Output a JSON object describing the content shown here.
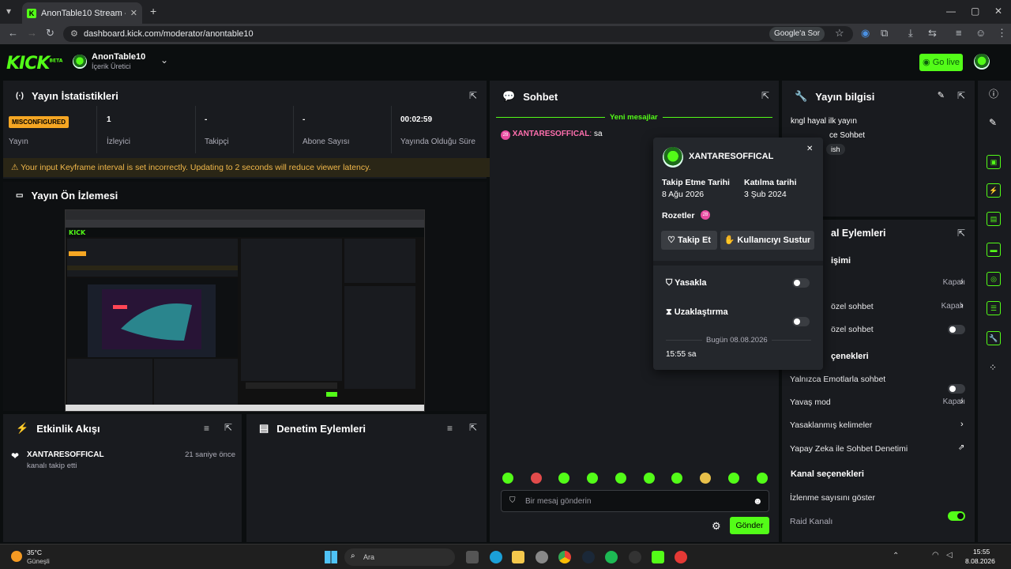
{
  "browser": {
    "tab_title": "AnonTable10 Stream - Kick Da",
    "url": "dashboard.kick.com/moderator/anontable10",
    "google_lens": "Google'a Sor"
  },
  "header": {
    "logo": "KICK",
    "logo_badge": "BETA",
    "channel_name": "AnonTable10",
    "channel_role": "İçerik Üretici",
    "go_live": "Go live"
  },
  "stats": {
    "title": "Yayın İstatistikleri",
    "badge": "MISCONFIGURED",
    "items": [
      {
        "value": "",
        "label": "Yayın"
      },
      {
        "value": "1",
        "label": "İzleyici"
      },
      {
        "value": "-",
        "label": "Takipçi"
      },
      {
        "value": "-",
        "label": "Abone Sayısı"
      },
      {
        "value": "00:02:59",
        "label": "Yayında Olduğu Süre"
      }
    ],
    "warning": "Your input Keyframe interval is set incorrectly. Updating to 2 seconds will reduce viewer latency."
  },
  "preview": {
    "title": "Yayın Ön İzlemesi"
  },
  "activity": {
    "title": "Etkinlik Akışı",
    "items": [
      {
        "user": "XANTARESOFFICAL",
        "text": "kanalı takip etti",
        "time": "21 saniye önce"
      }
    ]
  },
  "moderation": {
    "title": "Denetim Eylemleri"
  },
  "chat": {
    "title": "Sohbet",
    "new_messages": "Yeni mesajlar",
    "messages": [
      {
        "badge": "28",
        "user": "XANTARESOFFICAL",
        "text": "sa"
      }
    ],
    "input_placeholder": "Bir mesaj gönderin",
    "send": "Gönder"
  },
  "user_popup": {
    "username": "XANTARESOFFICAL",
    "follow_label": "Takip Etme Tarihi",
    "follow_date": "8 Ağu 2026",
    "join_label": "Katılma tarihi",
    "join_date": "3 Şub 2024",
    "badges_label": "Rozetler",
    "badge_num": "28",
    "follow_btn": "Takip Et",
    "mute_btn": "Kullanıcıyı Sustur",
    "ban_label": "Yasakla",
    "timeout_label": "Uzaklaştırma",
    "today": "Bugün 08.08.2026",
    "msg_time": "15:55",
    "msg_text": "sa"
  },
  "stream_info": {
    "title": "Yayın bilgisi",
    "stream_title": "kngl hayal ilk yayın",
    "category": "ce Sohbet",
    "tag": "ish"
  },
  "channel_actions": {
    "title": "al Eylemleri",
    "section1": "işimi",
    "rows": [
      {
        "label": "",
        "value": "Kapalı",
        "type": "arrow"
      },
      {
        "label": "özel sohbet",
        "value": "Kapalı",
        "type": "arrow"
      },
      {
        "label": "özel sohbet",
        "value": "",
        "type": "toggle"
      }
    ],
    "section2": "çenekleri",
    "rows2": [
      {
        "label": "Yalnızca Emotlarla sohbet",
        "value": "",
        "type": "toggle"
      },
      {
        "label": "Yavaş mod",
        "value": "Kapalı",
        "type": "arrow"
      },
      {
        "label": "Yasaklanmış kelimeler",
        "value": "",
        "type": "arrow"
      },
      {
        "label": "Yapay Zeka ile Sohbet Denetimi",
        "value": "",
        "type": "link"
      }
    ],
    "section3": "Kanal seçenekleri",
    "view_count": "İzlenme sayısını göster",
    "raid": "Raid Kanalı"
  },
  "taskbar": {
    "weather_temp": "35°C",
    "weather_desc": "Güneşli",
    "search": "Ara",
    "time": "15:55",
    "date": "8.08.2026"
  },
  "colors": {
    "accent": "#53fc18",
    "panel": "#191b1f",
    "warning": "#f5a623"
  }
}
